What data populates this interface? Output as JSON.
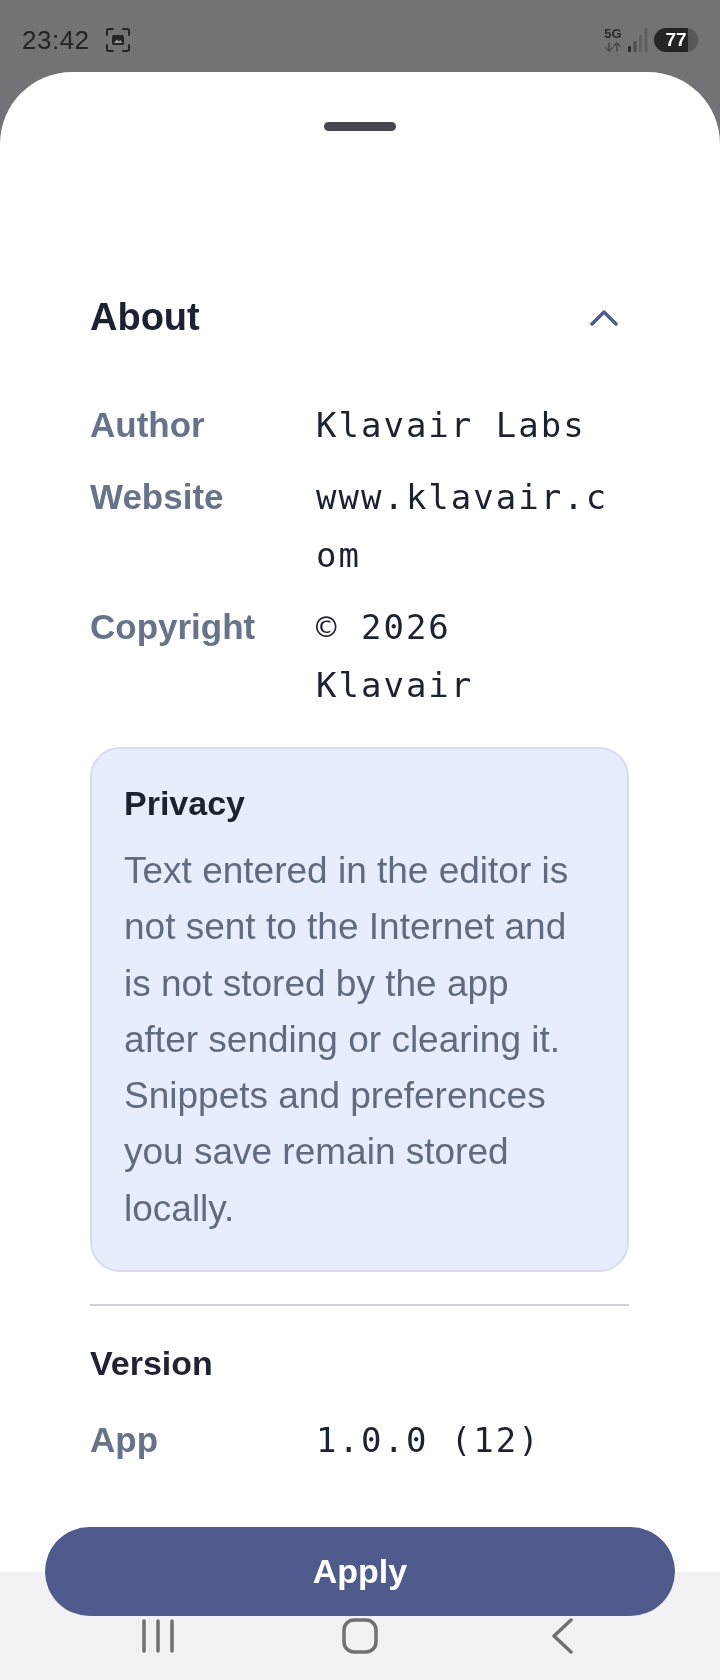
{
  "status_bar": {
    "time": "23:42",
    "network": "5G",
    "battery": "77"
  },
  "sheet": {
    "about": {
      "title": "About",
      "expanded": true,
      "rows": [
        {
          "label": "Author",
          "value": "Klavair Labs"
        },
        {
          "label": "Website",
          "value": "www.klavair.com"
        },
        {
          "label": "Copyright",
          "value": "© 2026 Klavair"
        }
      ],
      "notice": {
        "title": "Privacy",
        "text": "Text entered in the editor is not sent to the Internet and is not stored by the app after sending or clearing it. Snippets and preferences you save remain stored locally."
      }
    },
    "version": {
      "title": "Version",
      "rows": [
        {
          "label": "App",
          "value": "1.0.0 (12)"
        }
      ]
    },
    "apply_button": "Apply"
  }
}
